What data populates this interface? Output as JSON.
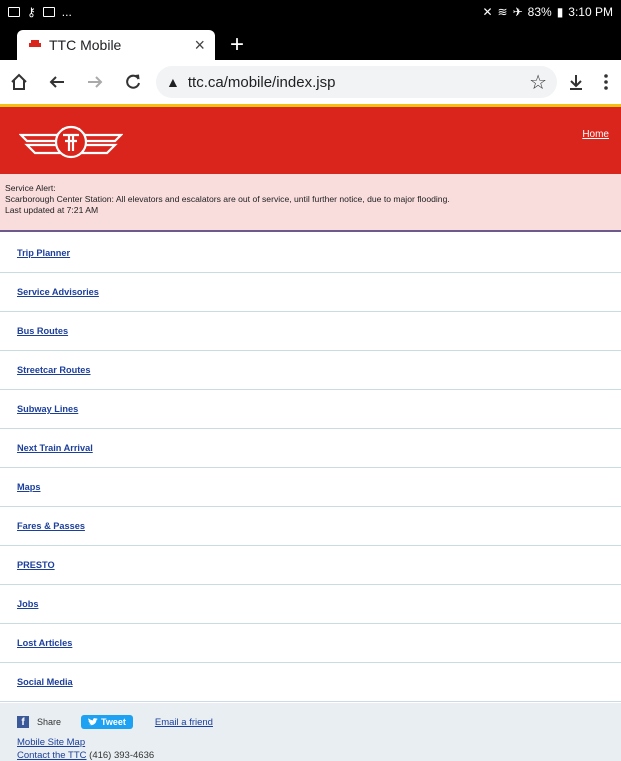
{
  "status_bar": {
    "left_ellipsis": "...",
    "battery": "83%",
    "time": "3:10 PM"
  },
  "browser": {
    "tab_title": "TTC Mobile",
    "tab_close": "×",
    "new_tab": "+",
    "url": "ttc.ca/mobile/index.jsp",
    "icons": [
      "home-icon",
      "back-icon",
      "forward-icon",
      "reload-icon",
      "not-secure-icon",
      "star-icon",
      "download-icon",
      "more-menu-icon"
    ]
  },
  "header": {
    "home_link": "Home",
    "colors": {
      "brand_red": "#da251d",
      "accent_yellow": "#f3c111"
    }
  },
  "alert": {
    "title": "Service Alert:",
    "message": "Scarborough Center Station: All elevators and escalators are out of service, until further notice, due to major flooding.",
    "updated": "Last updated at 7:21 AM"
  },
  "menu": {
    "items": [
      {
        "label": "Trip Planner"
      },
      {
        "label": "Service Advisories"
      },
      {
        "label": "Bus Routes"
      },
      {
        "label": "Streetcar Routes"
      },
      {
        "label": "Subway Lines"
      },
      {
        "label": "Next Train Arrival"
      },
      {
        "label": "Maps"
      },
      {
        "label": "Fares & Passes"
      },
      {
        "label": "PRESTO"
      },
      {
        "label": "Jobs"
      },
      {
        "label": "Lost Articles"
      },
      {
        "label": "Social Media"
      }
    ]
  },
  "footer": {
    "share_label": "Share",
    "tweet_label": "Tweet",
    "email_label": "Email a friend",
    "site_map_label": "Mobile Site Map",
    "contact_label": "Contact the TTC",
    "contact_phone": " (416) 393-4636"
  }
}
